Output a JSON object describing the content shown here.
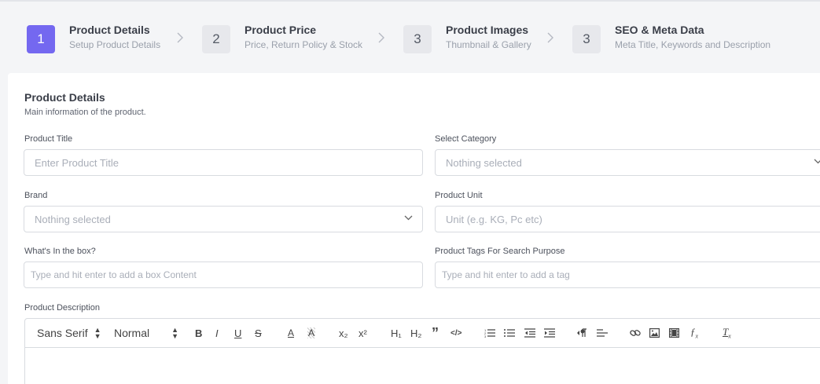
{
  "stepper": {
    "steps": [
      {
        "num": "1",
        "title": "Product Details",
        "subtitle": "Setup Product Details"
      },
      {
        "num": "2",
        "title": "Product Price",
        "subtitle": "Price, Return Policy & Stock"
      },
      {
        "num": "3",
        "title": "Product Images",
        "subtitle": "Thumbnail & Gallery"
      },
      {
        "num": "3",
        "title": "SEO & Meta Data",
        "subtitle": "Meta Title, Keywords and Description"
      }
    ],
    "active_step": 1,
    "active_color": "#7468f0"
  },
  "section": {
    "title": "Product Details",
    "subtitle": "Main information of the product."
  },
  "fields": {
    "product_title": {
      "label": "Product Title",
      "placeholder": "Enter Product Title",
      "value": ""
    },
    "category": {
      "label": "Select Category",
      "selected": "Nothing selected"
    },
    "brand": {
      "label": "Brand",
      "selected": "Nothing selected"
    },
    "unit": {
      "label": "Product Unit",
      "placeholder": "Unit (e.g. KG, Pc etc)",
      "value": ""
    },
    "box": {
      "label": "What's In the box?",
      "placeholder": "Type and hit enter to add a box Content"
    },
    "tags": {
      "label": "Product Tags For Search Purpose",
      "placeholder": "Type and hit enter to add a tag"
    },
    "description": {
      "label": "Product Description"
    }
  },
  "editor": {
    "font": "Sans Serif",
    "size": "Normal",
    "buttons": {
      "bold": "B",
      "italic": "I",
      "underline": "U",
      "strike": "S",
      "color": "A",
      "background": "A",
      "sub": "x₂",
      "sup": "x²",
      "h1": "H₁",
      "h2": "H₂",
      "quote": "”",
      "code": "</>",
      "clean": "Tx"
    },
    "icons": [
      "bold-icon",
      "italic-icon",
      "underline-icon",
      "strike-icon",
      "text-color-icon",
      "highlight-icon",
      "subscript-icon",
      "superscript-icon",
      "heading-1-icon",
      "heading-2-icon",
      "blockquote-icon",
      "code-icon",
      "ordered-list-icon",
      "bullet-list-icon",
      "outdent-icon",
      "indent-icon",
      "rtl-icon",
      "align-icon",
      "link-icon",
      "image-icon",
      "video-icon",
      "formula-icon",
      "clear-format-icon"
    ]
  }
}
